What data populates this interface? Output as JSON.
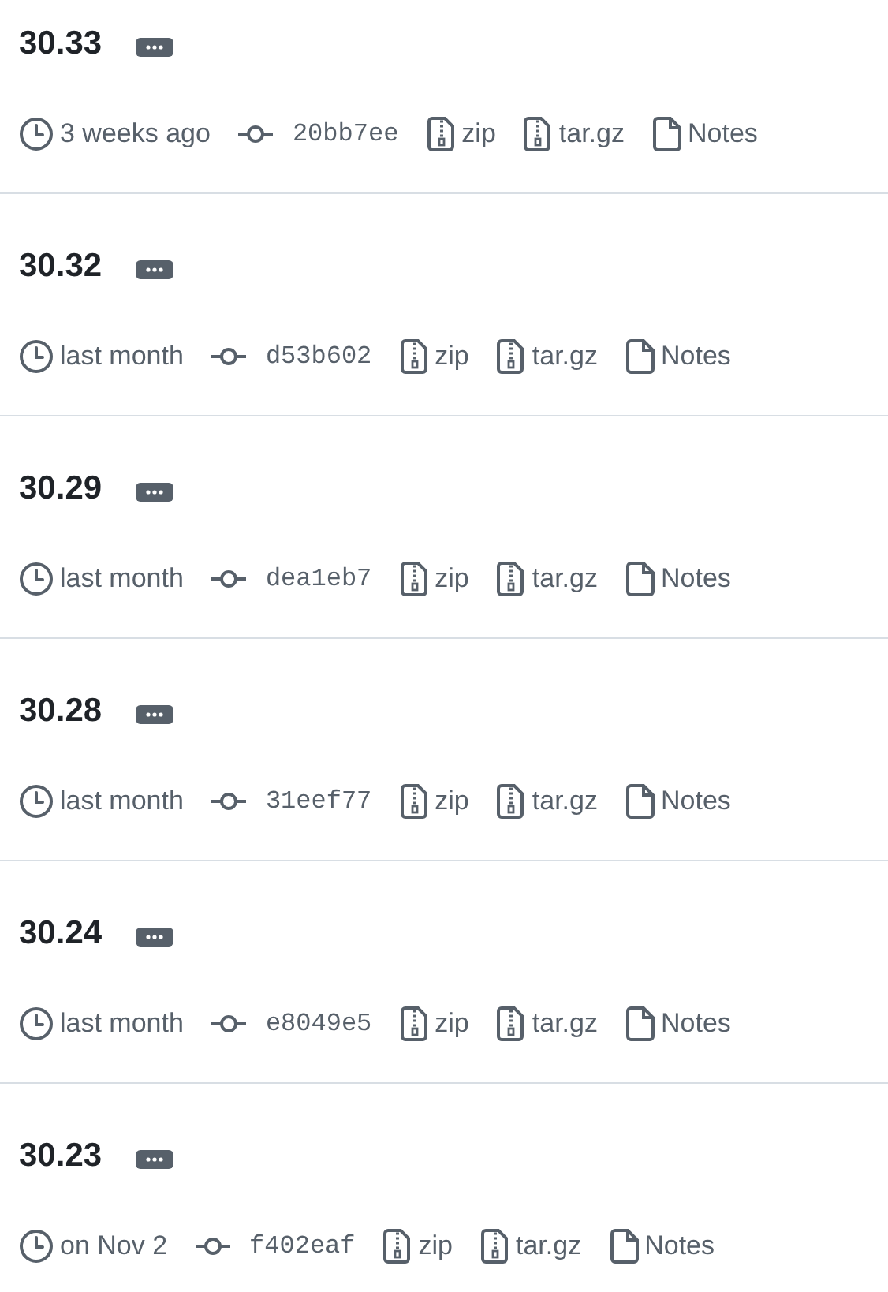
{
  "tags": [
    {
      "name": "30.33",
      "time": "3 weeks ago",
      "commit": "20bb7ee",
      "zip": "zip",
      "targz": "tar.gz",
      "notes": "Notes"
    },
    {
      "name": "30.32",
      "time": "last month",
      "commit": "d53b602",
      "zip": "zip",
      "targz": "tar.gz",
      "notes": "Notes"
    },
    {
      "name": "30.29",
      "time": "last month",
      "commit": "dea1eb7",
      "zip": "zip",
      "targz": "tar.gz",
      "notes": "Notes"
    },
    {
      "name": "30.28",
      "time": "last month",
      "commit": "31eef77",
      "zip": "zip",
      "targz": "tar.gz",
      "notes": "Notes"
    },
    {
      "name": "30.24",
      "time": "last month",
      "commit": "e8049e5",
      "zip": "zip",
      "targz": "tar.gz",
      "notes": "Notes"
    },
    {
      "name": "30.23",
      "time": "on Nov 2",
      "commit": "f402eaf",
      "zip": "zip",
      "targz": "tar.gz",
      "notes": "Notes"
    }
  ]
}
